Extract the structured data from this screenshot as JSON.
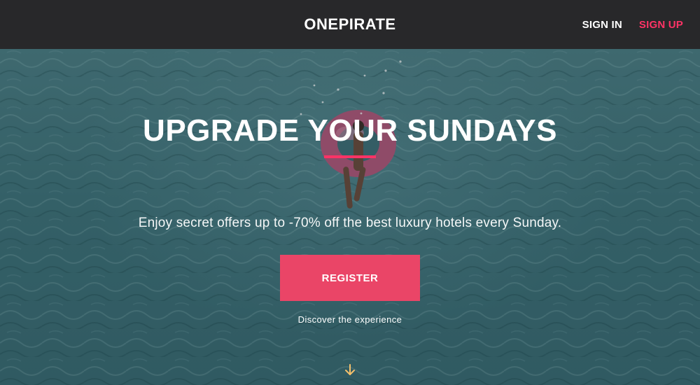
{
  "header": {
    "brand": "ONEPIRATE",
    "sign_in": "SIGN IN",
    "sign_up": "SIGN UP"
  },
  "hero": {
    "headline": "UPGRADE YOUR SUNDAYS",
    "subtitle": "Enjoy secret offers up to -70% off the best luxury hotels every Sunday.",
    "cta_label": "REGISTER",
    "discover_text": "Discover the experience",
    "scroll_icon": "arrow-down-icon"
  },
  "colors": {
    "topbar_bg": "#28282a",
    "accent_pink": "#ff3366",
    "button_bg": "#ea4567",
    "arrow": "#f5c16c",
    "water": "#3f737b"
  }
}
